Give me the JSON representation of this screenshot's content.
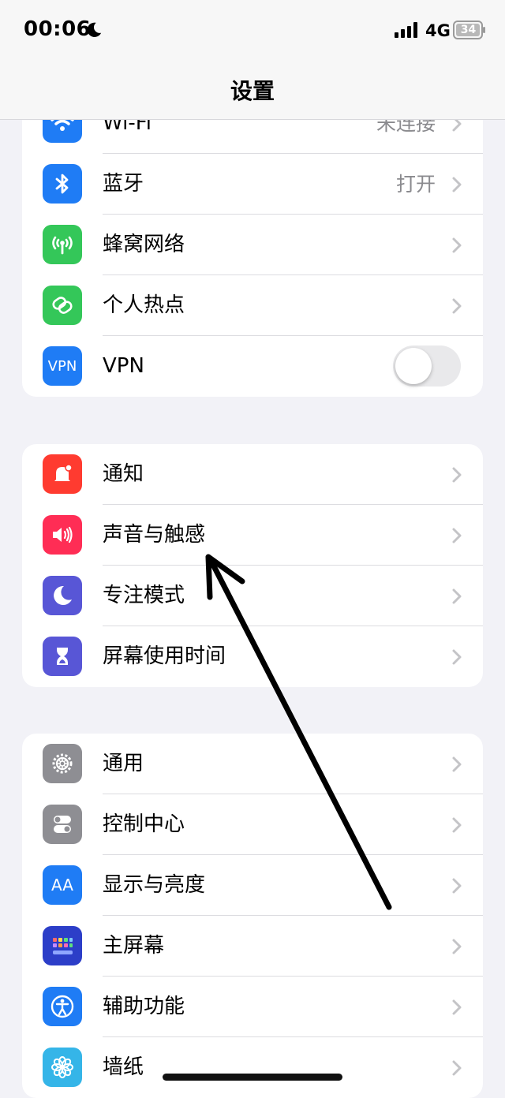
{
  "status": {
    "time": "00:06",
    "network": "4G",
    "battery": "34"
  },
  "nav": {
    "title": "设置"
  },
  "groups": [
    {
      "items": [
        {
          "label": "Wi-Fi",
          "value": "未连接",
          "icon": "wifi-icon",
          "color": "#1f7cf5"
        },
        {
          "label": "蓝牙",
          "value": "打开",
          "icon": "bluetooth-icon",
          "color": "#1f7cf5"
        },
        {
          "label": "蜂窝网络",
          "icon": "cellular-antenna-icon",
          "color": "#34c759"
        },
        {
          "label": "个人热点",
          "icon": "hotspot-link-icon",
          "color": "#34c759"
        },
        {
          "label": "VPN",
          "icon": "vpn-icon",
          "color": "#1f7cf5",
          "icon_text": "VPN",
          "toggle": false
        }
      ]
    },
    {
      "items": [
        {
          "label": "通知",
          "icon": "notification-bell-icon",
          "color": "#ff3b30"
        },
        {
          "label": "声音与触感",
          "icon": "speaker-icon",
          "color": "#ff2d55"
        },
        {
          "label": "专注模式",
          "icon": "moon-icon",
          "color": "#5856d6"
        },
        {
          "label": "屏幕使用时间",
          "icon": "hourglass-icon",
          "color": "#5856d6"
        }
      ]
    },
    {
      "items": [
        {
          "label": "通用",
          "icon": "gear-icon",
          "color": "#8e8e93"
        },
        {
          "label": "控制中心",
          "icon": "control-switches-icon",
          "color": "#8e8e93"
        },
        {
          "label": "显示与亮度",
          "icon": "text-size-icon",
          "color": "#1f7cf5",
          "icon_text": "AA"
        },
        {
          "label": "主屏幕",
          "icon": "home-screen-grid-icon",
          "color": "#2c3ec8"
        },
        {
          "label": "辅助功能",
          "icon": "accessibility-icon",
          "color": "#1f7cf5"
        },
        {
          "label": "墙纸",
          "icon": "wallpaper-flower-icon",
          "color": "#35b5e8"
        }
      ]
    }
  ]
}
